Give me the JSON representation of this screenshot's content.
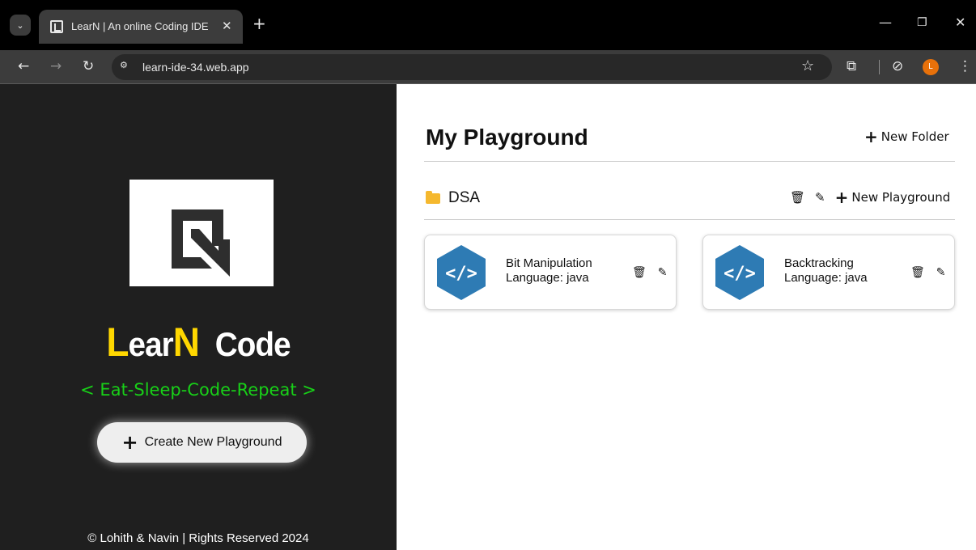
{
  "browser": {
    "tab_title": "LearN | An online Coding IDE",
    "url": "learn-ide-34.web.app",
    "profile_initial": "L"
  },
  "sidebar": {
    "brand_first_letter": "L",
    "brand_mid": "ear",
    "brand_n": "N",
    "brand_rest": "Code",
    "tagline": "< Eat-Sleep-Code-Repeat >",
    "create_button_label": "Create New Playground",
    "footer": "© Lohith & Navin | Rights Reserved 2024"
  },
  "main": {
    "title": "My Playground",
    "new_folder_label": "New Folder",
    "folder": {
      "name": "DSA",
      "new_playground_label": "New Playground",
      "playgrounds": [
        {
          "title": "Bit Manipulation",
          "language": "Language: java"
        },
        {
          "title": "Backtracking",
          "language": "Language: java"
        }
      ]
    }
  },
  "colors": {
    "sidebar_bg": "#1f1f1f",
    "brand_yellow": "#ffd700",
    "tagline_green": "#18d018",
    "code_logo_blue": "#2e7bb4",
    "folder_yellow": "#f5b82e"
  }
}
